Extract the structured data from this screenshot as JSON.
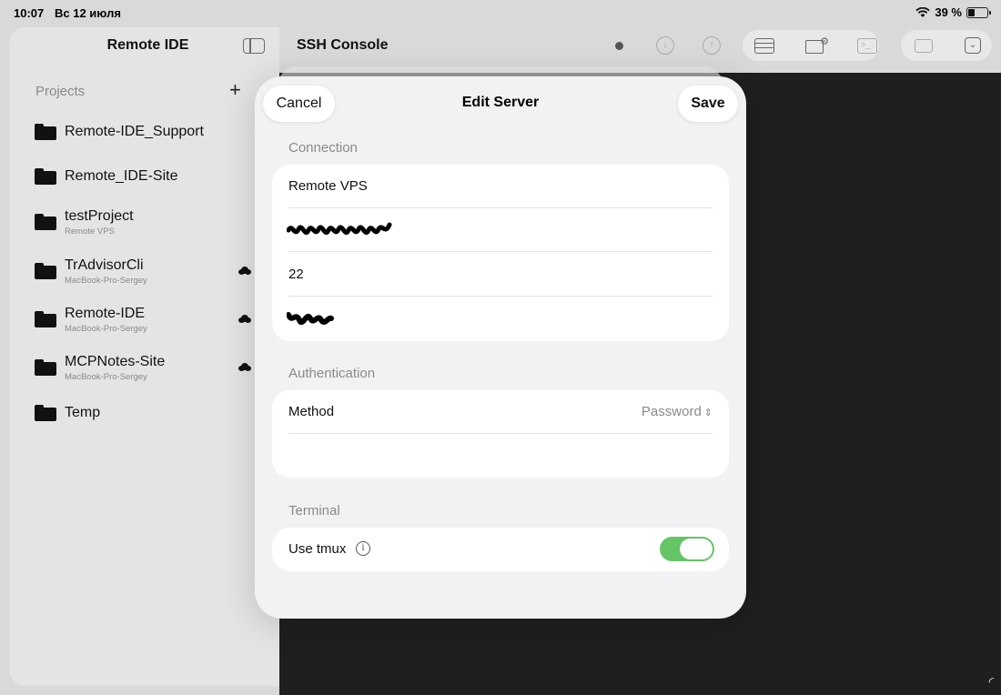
{
  "status_bar": {
    "time": "10:07",
    "date": "Вс 12 июля",
    "battery_text": "39 %",
    "battery_level": 0.39
  },
  "sidebar": {
    "title": "Remote IDE",
    "projects_label": "Projects",
    "add_symbol": "+",
    "projects": [
      {
        "name": "Remote-IDE_Support",
        "subtitle": "",
        "cloud": false
      },
      {
        "name": "Remote_IDE-Site",
        "subtitle": "",
        "cloud": false
      },
      {
        "name": "testProject",
        "subtitle": "Remote VPS",
        "cloud": false
      },
      {
        "name": "TrAdvisorCli",
        "subtitle": "MacBook-Pro-Sergey",
        "cloud": true
      },
      {
        "name": "Remote-IDE",
        "subtitle": "MacBook-Pro-Sergey",
        "cloud": true
      },
      {
        "name": "MCPNotes-Site",
        "subtitle": "MacBook-Pro-Sergey",
        "cloud": true
      },
      {
        "name": "Temp",
        "subtitle": "",
        "cloud": false
      }
    ]
  },
  "toolbar": {
    "title": "SSH Console",
    "icons": [
      "status-dot-icon",
      "download-icon",
      "upload-icon",
      "servers-icon",
      "folder-settings-icon",
      "terminal-icon",
      "windows-icon",
      "chevron-down-icon"
    ]
  },
  "sheet": {
    "title": "Edit Server",
    "cancel_label": "Cancel",
    "save_label": "Save",
    "connection_label": "Connection",
    "connection_name": "Remote VPS",
    "port": "22",
    "authentication_label": "Authentication",
    "method_label": "Method",
    "method_value": "Password",
    "terminal_label": "Terminal",
    "tmux_label": "Use tmux",
    "tmux_enabled": true
  },
  "colors": {
    "toggle_on": "#65c466",
    "terminal_bg": "#1f1f1f",
    "secondary_text": "#8a8a8e"
  }
}
